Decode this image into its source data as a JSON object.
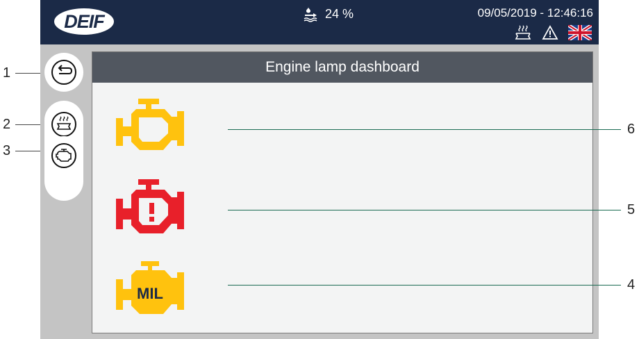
{
  "callouts": [
    "1",
    "2",
    "3",
    "6",
    "5",
    "4"
  ],
  "header": {
    "logo_text": "DEIF",
    "fuel_level": "24 %",
    "datetime": "09/05/2019 - 12:46:16"
  },
  "panel": {
    "title": "Engine lamp dashboard"
  },
  "lamps": [
    {
      "icon": "engine-check-icon",
      "color": "#ffc20e"
    },
    {
      "icon": "engine-warning-icon",
      "color": "#e8202a"
    },
    {
      "icon": "engine-mil-icon",
      "color": "#ffc20e",
      "text": "MIL"
    }
  ],
  "colors": {
    "topbar": "#1b2a47",
    "screen_bg": "#c4c4c4",
    "title_bar": "#515760",
    "callout_line": "#1a6b52"
  }
}
